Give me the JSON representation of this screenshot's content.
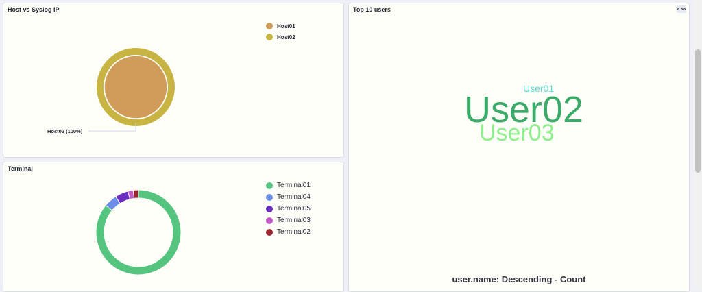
{
  "panels": {
    "host": {
      "title": "Host vs Syslog IP",
      "legend": [
        {
          "label": "Host01",
          "color": "#d19c5a"
        },
        {
          "label": "Host02",
          "color": "#c7b442"
        }
      ],
      "slice_label": "Host02 (100%)",
      "colors": {
        "inner": "#d19c5a",
        "ring": "#c7b442"
      }
    },
    "terminal": {
      "title": "Terminal",
      "legend": [
        {
          "label": "Terminal01",
          "color": "#54c47f",
          "value": 86
        },
        {
          "label": "Terminal04",
          "color": "#6d8ee6",
          "value": 5
        },
        {
          "label": "Terminal05",
          "color": "#6a2fc0",
          "value": 5
        },
        {
          "label": "Terminal03",
          "color": "#c45ac8",
          "value": 2
        },
        {
          "label": "Terminal02",
          "color": "#9a2330",
          "value": 2
        }
      ]
    },
    "users": {
      "title": "Top 10 users",
      "words": [
        {
          "text": "User01",
          "color": "#5bd6d0"
        },
        {
          "text": "User02",
          "color": "#3cab6a"
        },
        {
          "text": "User03",
          "color": "#8ef08a"
        }
      ],
      "footer": "user.name: Descending - Count"
    }
  }
}
